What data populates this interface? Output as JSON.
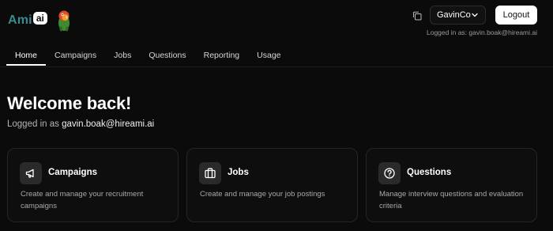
{
  "header": {
    "logo_text": "Ami",
    "logo_badge": "ai",
    "org_selector": {
      "value": "GavinCo"
    },
    "logout_label": "Logout",
    "logged_in_small": "Logged in as: gavin.boak@hireami.ai"
  },
  "tabs": [
    {
      "label": "Home",
      "active": true
    },
    {
      "label": "Campaigns",
      "active": false
    },
    {
      "label": "Jobs",
      "active": false
    },
    {
      "label": "Questions",
      "active": false
    },
    {
      "label": "Reporting",
      "active": false
    },
    {
      "label": "Usage",
      "active": false
    }
  ],
  "main": {
    "welcome_title": "Welcome back!",
    "logged_in_prefix": "Logged in as",
    "logged_in_email": "gavin.boak@hireami.ai"
  },
  "cards": [
    {
      "title": "Campaigns",
      "description": "Create and manage your recruitment campaigns",
      "icon": "megaphone-icon"
    },
    {
      "title": "Jobs",
      "description": "Create and manage your job postings",
      "icon": "briefcase-icon"
    },
    {
      "title": "Questions",
      "description": "Manage interview questions and evaluation criteria",
      "icon": "question-circle-icon"
    }
  ],
  "colors": {
    "background": "#0b0b0b",
    "logo_teal": "#3a8a8f",
    "card_border": "#262626",
    "muted_text": "#a8a8a8"
  }
}
